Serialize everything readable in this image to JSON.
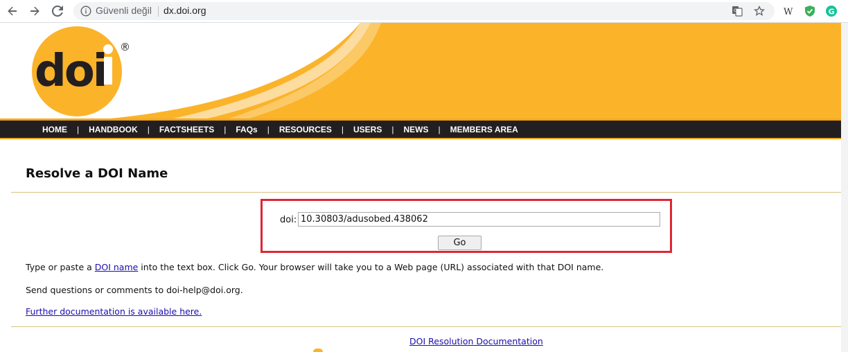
{
  "browser": {
    "security_label": "Güvenli değil",
    "url": "dx.doi.org"
  },
  "header": {
    "logo_text": "doi",
    "registered_mark": "®",
    "brand_colors": {
      "orange": "#fbb32a",
      "dark": "#231f20",
      "accent": "#f3a71f"
    }
  },
  "menu": {
    "items": [
      {
        "label": "HOME"
      },
      {
        "label": "HANDBOOK"
      },
      {
        "label": "FACTSHEETS"
      },
      {
        "label": "FAQs"
      },
      {
        "label": "RESOURCES"
      },
      {
        "label": "USERS"
      },
      {
        "label": "NEWS"
      },
      {
        "label": "MEMBERS AREA"
      }
    ],
    "separator": "|"
  },
  "main": {
    "title": "Resolve a DOI Name",
    "form": {
      "label": "doi:",
      "input_value": "10.30803/adusobed.438062",
      "submit_label": "Go"
    },
    "instructions": {
      "before": "Type or paste a ",
      "link": "DOI name",
      "after": " into the text box. Click Go. Your browser will take you to a Web page (URL) associated with that DOI name."
    },
    "contact": "Send questions or comments to doi-help@doi.org.",
    "docs_link": "Further documentation is available here."
  },
  "footer": {
    "link": "DOI Resolution Documentation"
  }
}
